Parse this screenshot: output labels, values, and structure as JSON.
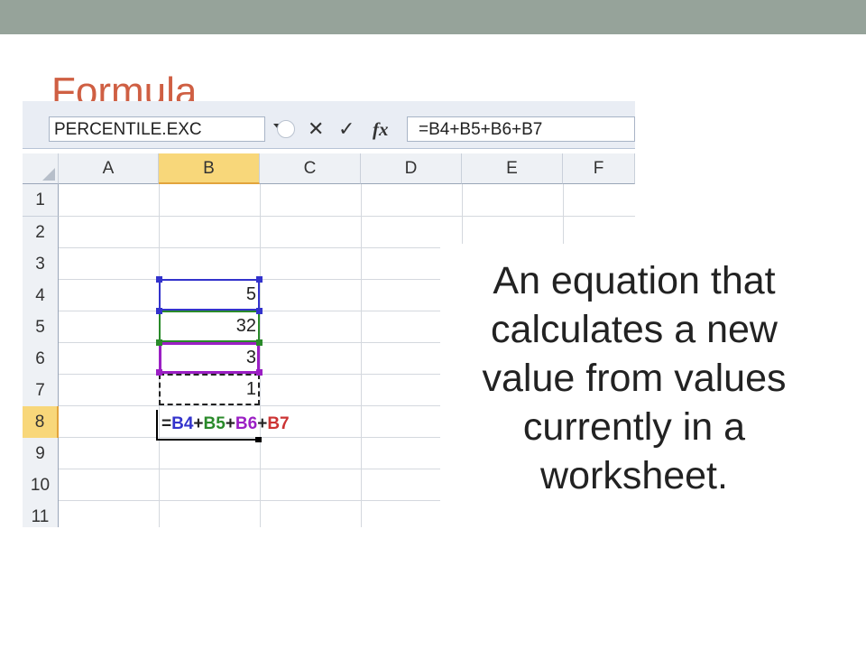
{
  "slide": {
    "title": "Formula",
    "caption": "An equation that calculates a new value from values currently in a worksheet."
  },
  "formula_bar": {
    "name_box": "PERCENTILE.EXC",
    "cancel_icon": "✕",
    "enter_icon": "✓",
    "fx_label": "fx",
    "formula": "=B4+B5+B6+B7"
  },
  "grid": {
    "columns": [
      "A",
      "B",
      "C",
      "D",
      "E",
      "F"
    ],
    "selected_column": "B",
    "rows": [
      "1",
      "2",
      "3",
      "4",
      "5",
      "6",
      "7",
      "8",
      "9",
      "10",
      "11"
    ],
    "selected_row": "8",
    "cells": {
      "B4": "5",
      "B5": "32",
      "B6": "3",
      "B7": "1"
    },
    "edit_cell": {
      "address": "B8",
      "parts": [
        "=",
        "B4",
        "+",
        "B5",
        "+",
        "B6",
        "+",
        "B7"
      ]
    }
  },
  "colors": {
    "topbar": "#96a39a",
    "title": "#cf5f43",
    "ref_b4": "#3333cc",
    "ref_b5": "#2a8a2a",
    "ref_b6": "#9b1fc4",
    "ref_b7": "#222222",
    "b7_text": "#cc3333"
  }
}
